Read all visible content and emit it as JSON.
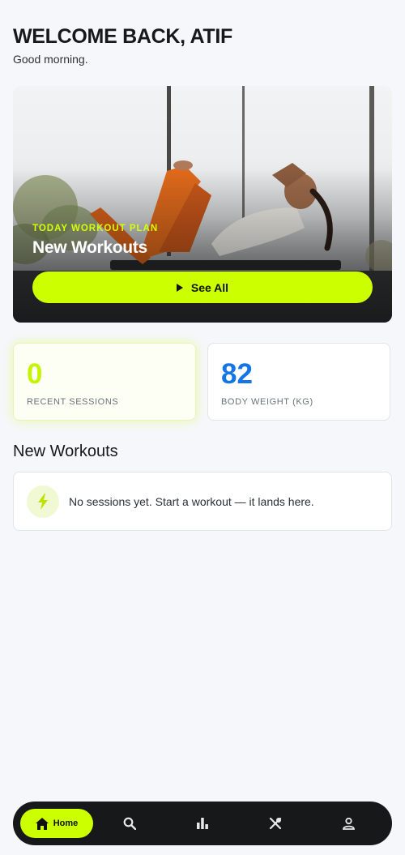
{
  "header": {
    "title": "WELCOME BACK, ATIF",
    "subtitle": "Good morning."
  },
  "hero": {
    "kicker": "TODAY WORKOUT PLAN",
    "title": "New Workouts",
    "button_label": "See All",
    "button_icon": "play-icon"
  },
  "stats": [
    {
      "value": "0",
      "label": "RECENT SESSIONS",
      "color": "#c5f500"
    },
    {
      "value": "82",
      "label": "BODY WEIGHT (KG)",
      "color": "#1476e6"
    }
  ],
  "section": {
    "title": "New Workouts",
    "empty_text": "No sessions yet. Start a workout — it lands here.",
    "empty_icon": "bolt-icon"
  },
  "nav": {
    "home_label": "Home",
    "items": [
      "home-icon",
      "search-icon",
      "stats-icon",
      "nutrition-icon",
      "profile-icon"
    ]
  },
  "colors": {
    "accent": "#ccff00",
    "blue": "#1476e6",
    "nav_bg": "#17181a",
    "background": "#f6f7fb"
  }
}
